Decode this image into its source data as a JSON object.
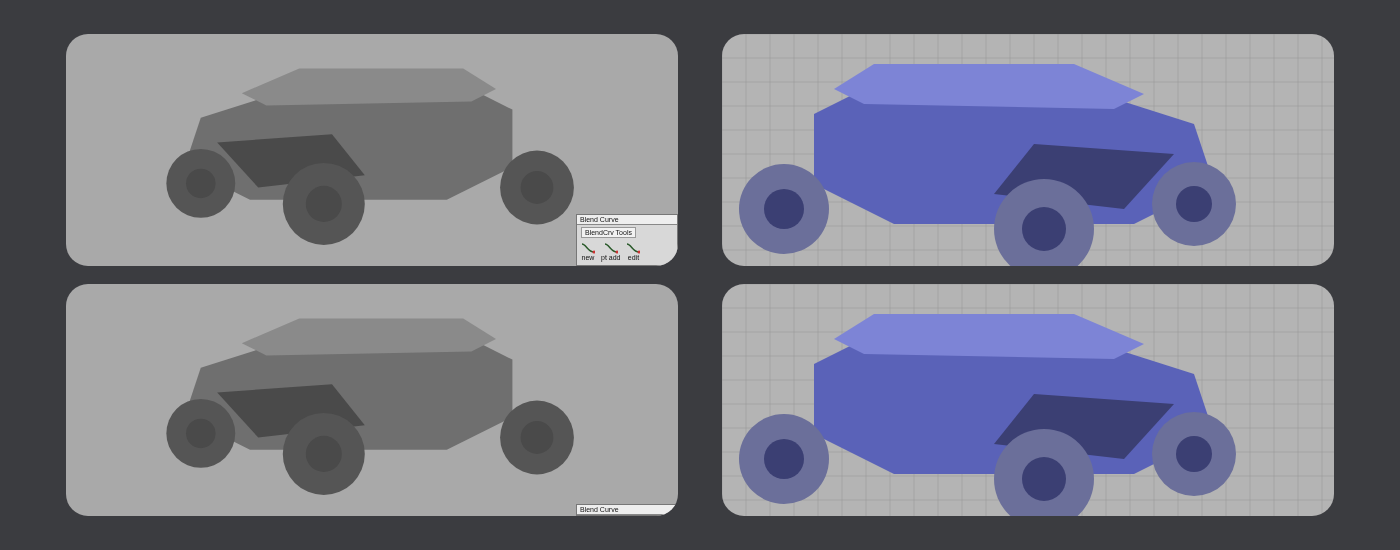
{
  "viewports": [
    {
      "kind": "gray",
      "palette": {
        "title": "Blend Curve",
        "tab": "BlendCrv Tools",
        "tools": [
          "new",
          "pt add",
          "edit"
        ]
      }
    },
    {
      "kind": "blue"
    },
    {
      "kind": "gray",
      "palette": {
        "title": "Blend Curve"
      }
    },
    {
      "kind": "blue"
    }
  ]
}
